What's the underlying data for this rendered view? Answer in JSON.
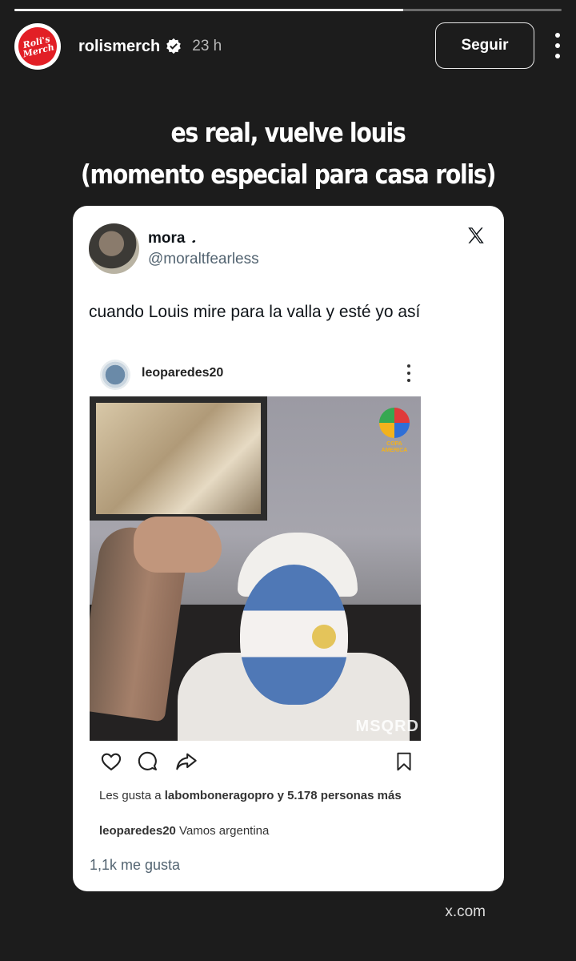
{
  "story": {
    "progress": 0.71,
    "account": {
      "avatar_text": "Roli's Merch",
      "username": "rolismerch",
      "verified": true,
      "time_ago": "23 h"
    },
    "follow_label": "Seguir",
    "caption_line1": "es real, vuelve louis",
    "caption_line2": "(momento especial para casa rolis)",
    "source": "x.com"
  },
  "tweet": {
    "name": "mora",
    "name_emoji": "𝅘",
    "handle": "@moraltfearless",
    "text": "cuando Louis mire para la valla y esté yo así",
    "likes": "1,1k me gusta",
    "embedded_post": {
      "user": "leoparedes20",
      "watermark": "MSQRD",
      "logo_text": "COPA AMERICA",
      "likes_user": "labomboneragopro",
      "likes_rest": " y 5.178 personas más",
      "likes_prefix": "Les gusta a ",
      "caption_user": "leoparedes20",
      "caption_text": " Vamos argentina"
    }
  },
  "colors": {
    "background": "#1c1c1c",
    "card": "#ffffff",
    "handle_gray": "#536471",
    "roli_red": "#e21f26"
  }
}
